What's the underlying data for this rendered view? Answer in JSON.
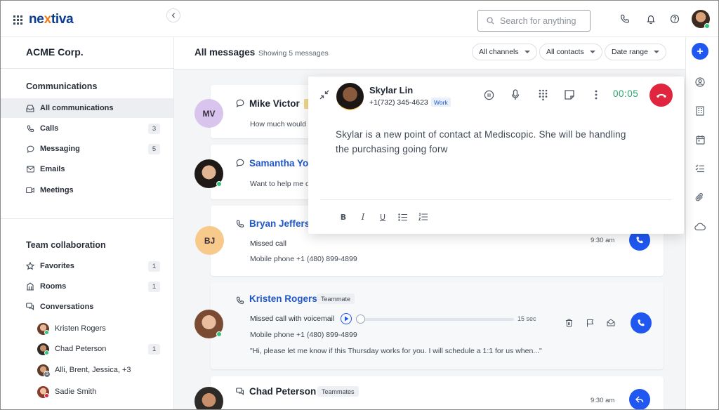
{
  "app": {
    "logo_prefix": "ne",
    "logo_x": "x",
    "logo_suffix": "tiva"
  },
  "search": {
    "placeholder": "Search for anything"
  },
  "sidebar": {
    "org": "ACME Corp.",
    "communications_title": "Communications",
    "items": [
      {
        "label": "All communications",
        "count": ""
      },
      {
        "label": "Calls",
        "count": "3"
      },
      {
        "label": "Messaging",
        "count": "5"
      },
      {
        "label": "Emails",
        "count": ""
      },
      {
        "label": "Meetings",
        "count": ""
      }
    ],
    "team_title": "Team collaboration",
    "team_items": [
      {
        "label": "Favorites",
        "count": "1"
      },
      {
        "label": "Rooms",
        "count": "1"
      },
      {
        "label": "Conversations",
        "count": ""
      }
    ],
    "conversations": [
      {
        "name": "Kristen Rogers",
        "count": ""
      },
      {
        "name": "Chad Peterson",
        "count": "1"
      },
      {
        "name": "Alli, Brent, Jessica, +3",
        "count": ""
      },
      {
        "name": "Sadie Smith",
        "count": ""
      }
    ]
  },
  "main": {
    "title": "All messages",
    "subtitle": "Showing 5 messages",
    "filters": [
      "All channels",
      "All contacts",
      "Date range"
    ]
  },
  "feed": [
    {
      "initials": "MV",
      "name": "Mike Victor",
      "preview": "How much would i"
    },
    {
      "name": "Samantha You",
      "preview": "Want to help me o"
    },
    {
      "initials": "BJ",
      "name": "Bryan Jeffers",
      "line1": "Missed call",
      "line2": "Mobile phone +1 (480) 899-4899",
      "time": "9:30 am"
    },
    {
      "name": "Kristen Rogers",
      "tag": "Teammate",
      "line1": "Missed call with voicemail",
      "duration": "15 sec",
      "line2": "Mobile phone +1 (480) 899-4899",
      "quote": "\"Hi, please let me know if this Thursday works for you. I will schedule a 1:1 for us when...\""
    },
    {
      "name": "Chad Peterson",
      "tag": "Teammates",
      "time": "9:30 am"
    }
  ],
  "call": {
    "name": "Skylar Lin",
    "phone": "+1(732) 345-4623",
    "phone_tag": "Work",
    "timer": "00:05",
    "note": "Skylar is a new point of contact at Mediscopic. She will be handling the purchasing going forw"
  },
  "colors": {
    "brand_blue": "#1f57f0",
    "hangup_red": "#e0263e",
    "timer_green": "#2aa26b",
    "logo_navy": "#0a3d8f",
    "logo_orange": "#f07a1a"
  }
}
